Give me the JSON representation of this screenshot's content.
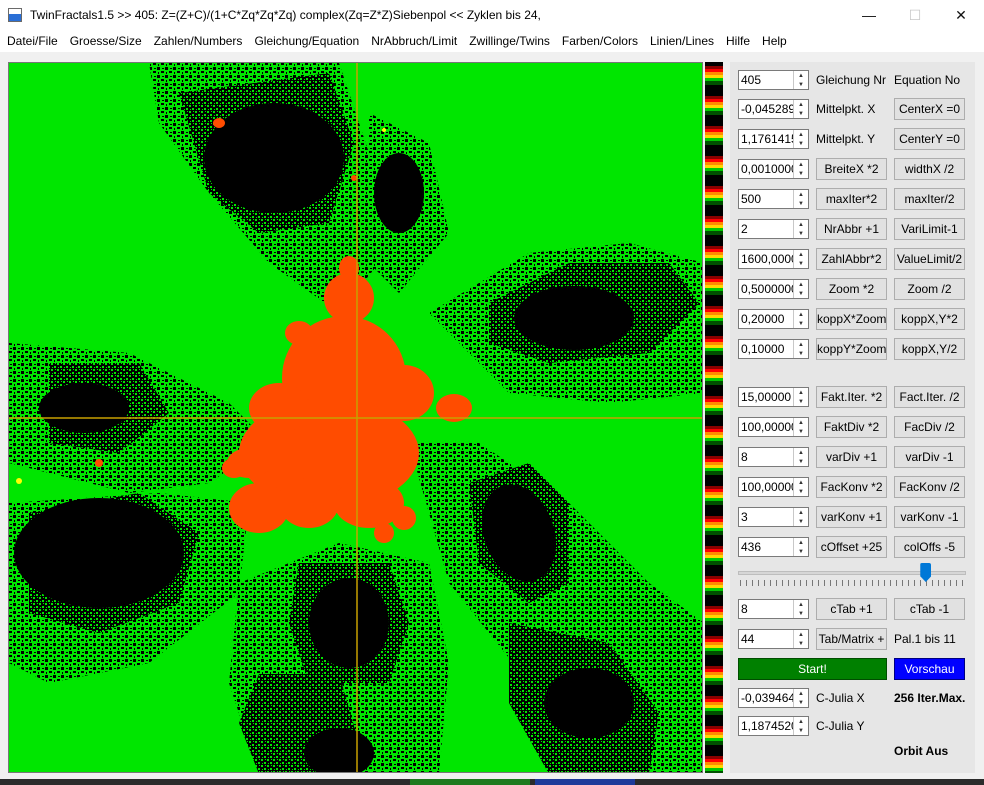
{
  "window": {
    "title": "TwinFractals1.5 >> 405: Z=(Z+C)/(1+C*Zq*Zq*Zq) complex(Zq=Z*Z)Siebenpol <<  Zyklen bis 24,",
    "min_symbol": "—",
    "max_symbol": "☐",
    "close_symbol": "✕"
  },
  "menu": [
    "Datei/File",
    "Groesse/Size",
    "Zahlen/Numbers",
    "Gleichung/Equation",
    "NrAbbruch/Limit",
    "Zwillinge/Twins",
    "Farben/Colors",
    "Linien/Lines",
    "Hilfe",
    "Help"
  ],
  "colors": {
    "fractal_bg": "#00e600",
    "fractal_inner": "#ff4c00",
    "fractal_black": "#000000",
    "crosshair": "#c8a000",
    "start": "#008000",
    "vorschau": "#0000ff"
  },
  "controls": {
    "equation_nr": "405",
    "equation_label": "Gleichung Nr",
    "equation_label_en": "Equation No",
    "center_x_val": "-0,0452890",
    "center_x_label": "Mittelpkt. X",
    "center_x_btn": "CenterX =0",
    "center_y_val": "1,17614150",
    "center_y_label": "Mittelpkt. Y",
    "center_y_btn": "CenterY =0",
    "breite_val": "0,00100000",
    "breite_btn": "BreiteX *2",
    "width_btn": "widthX /2",
    "maxiter_val": "500",
    "maxiter_mul": "maxIter*2",
    "maxiter_div": "maxIter/2",
    "nrabbr_val": "2",
    "nrabbr_btn": "NrAbbr +1",
    "varilimit_btn": "VariLimit-1",
    "zahlabbr_val": "1600,00000",
    "zahlabbr_btn": "ZahlAbbr*2",
    "valuelimit_btn": "ValueLimit/2",
    "zoom_val": "0,50000000",
    "zoom_mul": "Zoom *2",
    "zoom_div": "Zoom /2",
    "koppx_val": "0,20000",
    "koppx_btn": "koppX*Zoom",
    "koppxy_mul": "koppX,Y*2",
    "koppy_val": "0,10000",
    "koppy_btn": "koppY*Zoom",
    "koppxy_div": "koppX,Y/2",
    "faktiter_val": "15,00000",
    "faktiter_mul": "Fakt.Iter. *2",
    "factiter_div": "Fact.Iter. /2",
    "faktdiv_val": "100,00000",
    "faktdiv_mul": "FaktDiv *2",
    "facdiv_div": "FacDiv /2",
    "vardiv_val": "8",
    "vardiv_inc": "varDiv +1",
    "vardiv_dec": "varDiv -1",
    "fackonv_val": "100,00000",
    "fackonv_mul": "FacKonv *2",
    "fackonv_div": "FacKonv /2",
    "varkonv_val": "3",
    "varkonv_inc": "varKonv +1",
    "varkonv_dec": "varKonv -1",
    "coffset_val": "436",
    "coffset_inc": "cOffset +25",
    "coloffs_dec": "colOffs -5",
    "slider_value": 0.84,
    "ctab_val": "8",
    "ctab_inc": "cTab +1",
    "ctab_dec": "cTab -1",
    "tabmatrix_val": "44",
    "tabmatrix_btn": "Tab/Matrix +",
    "pal_label": "Pal.1 bis 11",
    "start_btn": "Start!",
    "vorschau_btn": "Vorschau",
    "cjulia_x_val": "-0,03946490",
    "cjulia_x_label": "C-Julia X",
    "itermax_label": "256 Iter.Max.",
    "cjulia_y_val": "1,18745200",
    "cjulia_y_label": "C-Julia Y",
    "orbit_label": "Orbit Aus"
  }
}
